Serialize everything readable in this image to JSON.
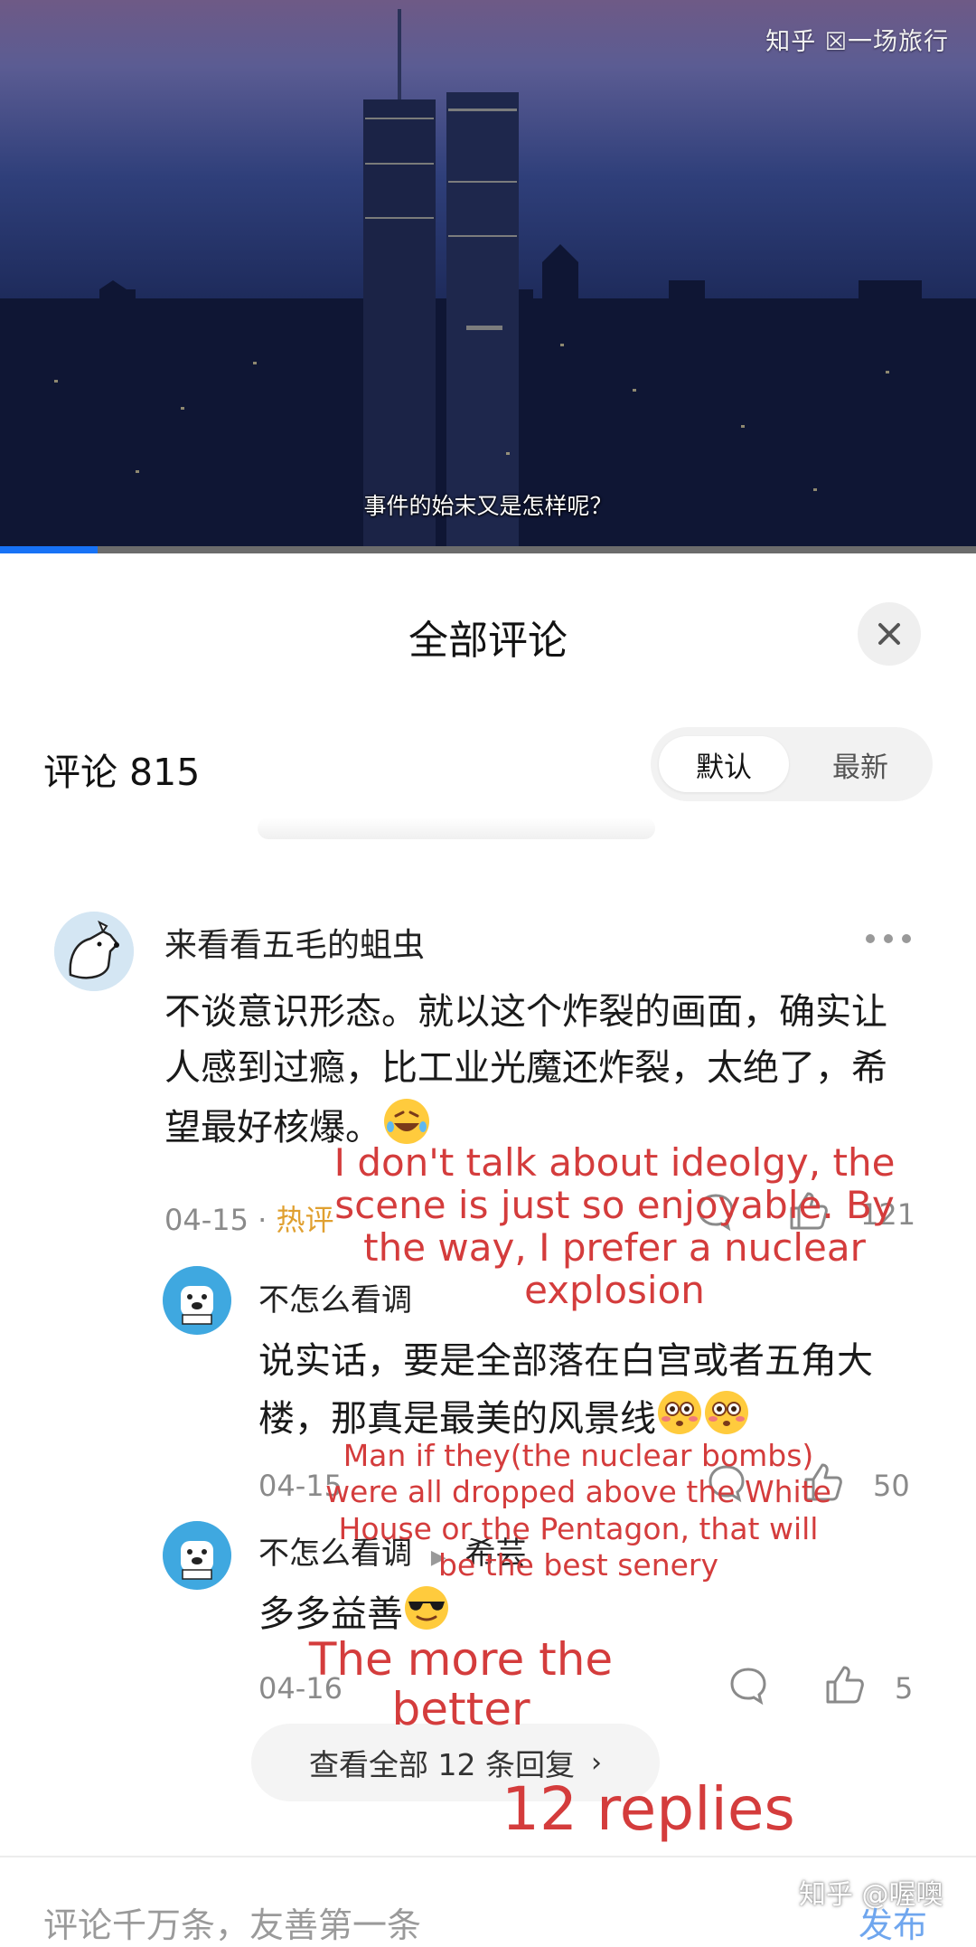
{
  "video": {
    "watermark": "知乎 ☒一场旅行",
    "subtitle": "事件的始末又是怎样呢？",
    "progress": 0.1
  },
  "sheet": {
    "title": "全部评论",
    "close_icon": "close-icon",
    "count_label": "评论 815",
    "sort_options": [
      "默认",
      "最新"
    ],
    "sort_selected": "默认"
  },
  "comments": [
    {
      "author": "来看看五毛的蛆虫",
      "avatar_icon": "dog-avatar-icon",
      "text": "不谈意识形态。就以这个炸裂的画面，确实让人感到过瘾，比工业光魔还炸裂，太绝了，希望最好核爆。",
      "emoji": "rofl-emoji",
      "date": "04-15",
      "tag": "热评",
      "likes": "121",
      "replies": [
        {
          "author": "不怎么看调",
          "avatar_icon": "polar-bear-avatar-icon",
          "text": "说实话，要是全部落在白宫或者五角大楼，那真是最美的风景线",
          "emoji": "flushed-emoji",
          "date": "04-15",
          "likes": "50"
        },
        {
          "author": "不怎么看调",
          "reply_to": "希芸",
          "avatar_icon": "polar-bear-avatar-icon",
          "text": "多多益善",
          "emoji": "sunglasses-emoji",
          "date": "04-16",
          "likes": "5"
        }
      ],
      "view_all_replies": "查看全部 12 条回复"
    }
  ],
  "overlay_translations": {
    "t1": "I don't talk about ideolgy, the scene is just so enjoyable. By the way, I prefer a nuclear explosion",
    "t2": "Man if they(the nuclear bombs) were all dropped above the White House or the Pentagon, that will be the best senery",
    "t3": "The more the better",
    "t4": "12 replies"
  },
  "bottom": {
    "input_placeholder": "评论千万条，友善第一条",
    "publish_label": "发布",
    "watermark": "知乎 @喔噢"
  },
  "colors": {
    "accent": "#1772f6",
    "overlay_red": "#d43c3c",
    "hot_tag": "#e0a030"
  }
}
